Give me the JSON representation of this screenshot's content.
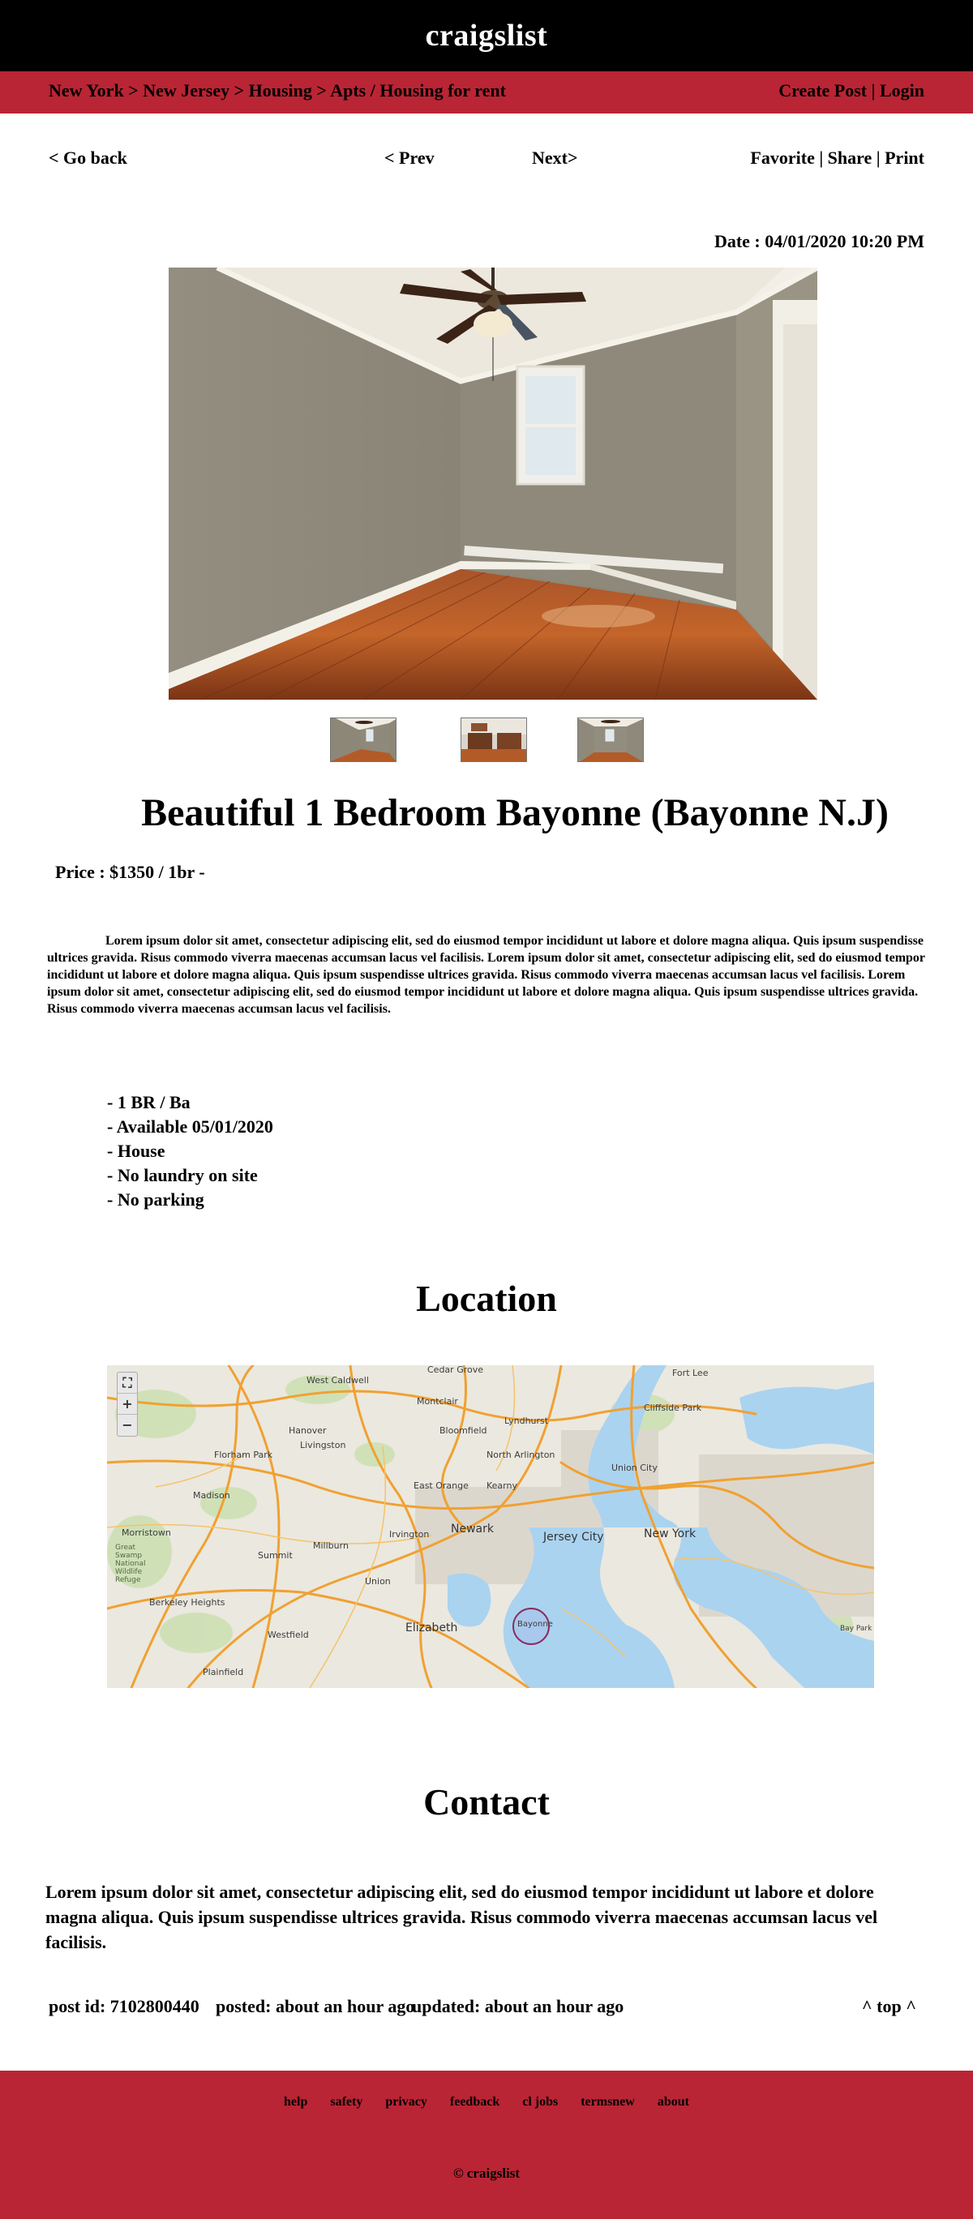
{
  "header": {
    "brand": "craigslist"
  },
  "breadcrumb": {
    "text": "New York > New Jersey > Housing > Apts / Housing for rent"
  },
  "account": {
    "text": "Create Post | Login"
  },
  "nav": {
    "go_back": "< Go back",
    "prev": "< Prev",
    "next": "Next>",
    "actions": "Favorite | Share | Print"
  },
  "post": {
    "date": "Date : 04/01/2020 10:20 PM",
    "title": "Beautiful 1 Bedroom Bayonne (Bayonne N.J)",
    "price": "Price : $1350 / 1br -",
    "description": "Lorem ipsum dolor sit amet, consectetur adipiscing elit, sed do eiusmod tempor incididunt ut labore et dolore magna aliqua. Quis ipsum suspendisse ultrices gravida. Risus commodo viverra maecenas accumsan lacus vel facilisis. Lorem ipsum dolor sit amet, consectetur adipiscing elit, sed do eiusmod tempor incididunt ut labore et dolore magna aliqua. Quis ipsum suspendisse ultrices gravida. Risus commodo viverra maecenas accumsan lacus vel facilisis. Lorem ipsum dolor sit amet, consectetur adipiscing elit, sed do eiusmod tempor incididunt ut labore et dolore magna aliqua. Quis ipsum suspendisse ultrices gravida. Risus commodo viverra maecenas accumsan lacus vel facilisis.",
    "attributes": [
      "- 1 BR / Ba",
      "- Available 05/01/2020",
      "- House",
      "- No laundry on site",
      "- No parking"
    ]
  },
  "location": {
    "heading": "Location",
    "labels": {
      "cedar_grove": "Cedar Grove",
      "west_caldwell": "West Caldwell",
      "montclair": "Montclair",
      "fort_lee": "Fort Lee",
      "hanover": "Hanover",
      "livingston": "Livingston",
      "bloomfield": "Bloomfield",
      "lyndhurst": "Lyndhurst",
      "cliffside_park": "Cliffside Park",
      "florham_park": "Florham Park",
      "north_arlington": "North Arlington",
      "union_city": "Union City",
      "madison": "Madison",
      "east_orange": "East Orange",
      "kearny": "Kearny",
      "newark": "Newark",
      "jersey_city": "Jersey City",
      "new_york": "New York",
      "morristown": "Morristown",
      "great_swamp": "Great Swamp National Wildlife Refuge",
      "summit": "Summit",
      "millburn": "Millburn",
      "irvington": "Irvington",
      "union": "Union",
      "berkeley_heights": "Berkeley Heights",
      "elizabeth": "Elizabeth",
      "bayonne": "Bayonne",
      "westfield": "Westfield",
      "plainfield": "Plainfield",
      "bay_park": "Bay Park"
    },
    "zoom_controls": [
      "⛶",
      "+",
      "−"
    ]
  },
  "contact": {
    "heading": "Contact",
    "text": "Lorem ipsum dolor sit amet, consectetur adipiscing elit, sed do eiusmod tempor incididunt ut labore et dolore magna aliqua. Quis ipsum suspendisse ultrices gravida. Risus commodo viverra maecenas accumsan lacus vel facilisis."
  },
  "meta": {
    "post_id": "post id: 7102800440",
    "posted": "posted: about an hour ago",
    "updated": "updated: about an hour ago",
    "top": "^ top ^"
  },
  "footer": {
    "links": [
      "help",
      "safety",
      "privacy",
      "feedback",
      "cl jobs",
      "termsnew",
      "about"
    ],
    "copyright": "© craigslist"
  },
  "colors": {
    "header_bg": "#000000",
    "accent_red": "#b92534",
    "map_water": "#aad3f0",
    "map_roads": "#f0a132"
  }
}
